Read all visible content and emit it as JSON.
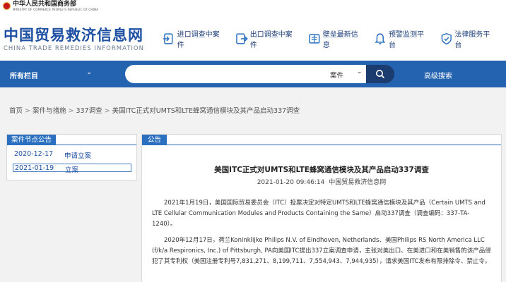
{
  "header": {
    "ministry_cn": "中华人民共和国商务部",
    "ministry_en": "MINISTRY OF COMMERCE PEOPLE'S REPUBLIC OF CHINA",
    "site_title_cn": "中国贸易救济信息网",
    "site_title_en": "CHINA TRADE REMEDIES INFORMATION",
    "nav": [
      {
        "label": "进口调查中案件",
        "icon": "import-case-icon"
      },
      {
        "label": "出口调查中案件",
        "icon": "export-case-icon"
      },
      {
        "label": "壁垒最新信息",
        "icon": "barrier-info-icon"
      },
      {
        "label": "预警监测平台",
        "icon": "bell-icon"
      },
      {
        "label": "法律服务平台",
        "icon": "shield-icon"
      }
    ]
  },
  "search": {
    "columns_label": "所有栏目",
    "query": "",
    "placeholder": "",
    "type_label": "案件",
    "advanced_label": "高级搜索"
  },
  "breadcrumb": {
    "items": [
      "首页",
      "案件与措施",
      "337调查",
      "美国ITC正式对UMTS和LTE蜂窝通信模块及其产品启动337调查"
    ]
  },
  "left_panel": {
    "title": "案件节点公告",
    "rows": [
      {
        "date": "2020-12-17",
        "label": "申请立案"
      },
      {
        "date": "2021-01-19",
        "label": "立案"
      }
    ]
  },
  "article": {
    "tab": "公告",
    "title": "美国ITC正式对UMTS和LTE蜂窝通信模块及其产品启动337调查",
    "datetime": "2021-01-20 09:46:14",
    "source": "中国贸易救济信息网",
    "paragraphs": [
      "2021年1月19日，美国国际贸易委员会（ITC）投票决定对特定UMTS和LTE蜂窝通信模块及其产品（Certain UMTS and LTE Cellular Communication Modules and Products Containing the Same）启动337调查（调查编码：337-TA-1240）。",
      "2020年12月17日，荷兰Koninklijke Philips N.V. of Eindhoven, Netherlands、美国Philips RS North America LLC (f/k/a Respironics, Inc.) of Pittsburgh, PA向美国ITC提出337立案调查申请，主张对美出口、在美进口和在美销售的该产品侵犯了其专利权（美国注册专利号7,831,271、8,199,711、7,554,943、7,944,935），请求美国ITC发布有限排除令、禁止令。"
    ]
  },
  "colors": {
    "brand_blue": "#1d4fa3",
    "bar_blue": "#2463b0",
    "search_button": "#1b3c6e"
  }
}
